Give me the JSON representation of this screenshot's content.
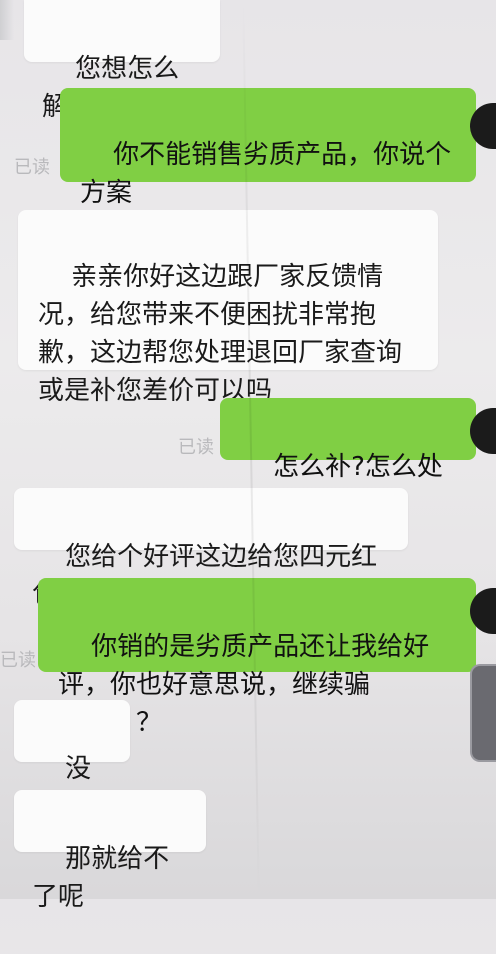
{
  "read_label": "已读",
  "messages": [
    {
      "side": "incoming",
      "text": "您想怎么解决"
    },
    {
      "side": "outgoing",
      "text": "你不能销售劣质产品，你说个方案",
      "read": "已读"
    },
    {
      "side": "incoming",
      "text": "亲亲你好这边跟厂家反馈情况，给您带来不便困扰非常抱歉，这边帮您处理退回厂家查询或是补您差价可以吗"
    },
    {
      "side": "outgoing",
      "text": "怎么补?怎么处理?",
      "read": "已读"
    },
    {
      "side": "incoming",
      "text": "您给个好评这边给您四元红包"
    },
    {
      "side": "outgoing",
      "text": "你销的是劣质产品还让我给好评，你也好意思说，继续骗人。？？",
      "read": "已读"
    },
    {
      "side": "incoming",
      "text": "没有的"
    },
    {
      "side": "incoming",
      "text": "那就给不了呢"
    }
  ],
  "colors": {
    "outgoing_bubble": "#80cf44",
    "incoming_bubble": "#fbfbfb",
    "background": "#e9e8ea",
    "read_receipt": "#b9b9bc"
  }
}
